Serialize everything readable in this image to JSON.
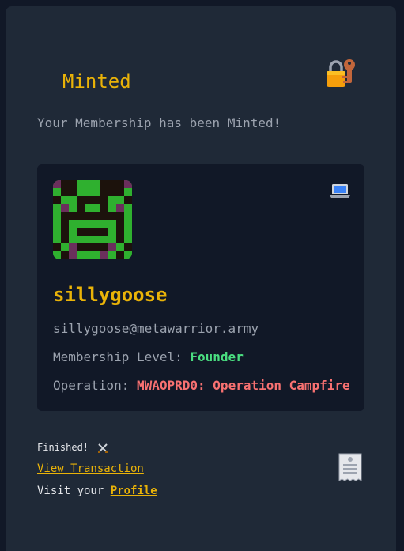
{
  "header": {
    "title": "Minted",
    "icon": "locked-with-key-icon"
  },
  "subtitle": "Your Membership has been Minted!",
  "membership": {
    "avatar_icon": "pixel-avatar",
    "device_icon": "laptop-icon",
    "username": "sillygoose",
    "email": "sillygoose@metawarrior.army",
    "level_label": "Membership Level: ",
    "level_value": "Founder",
    "operation_label": "Operation: ",
    "operation_value": "MWAOPRD0: Operation Campfire",
    "colors": {
      "level": "#4ade80",
      "operation": "#f87171",
      "username": "#eab308"
    }
  },
  "footer": {
    "finished_text": "Finished!",
    "finished_icon": "crossed-swords-icon",
    "view_transaction_label": "View Transaction",
    "visit_text": "Visit your ",
    "profile_label": "Profile",
    "receipt_icon": "receipt-icon"
  },
  "colors": {
    "accent": "#eab308",
    "card_bg": "#1f2937",
    "page_bg": "#111827"
  }
}
